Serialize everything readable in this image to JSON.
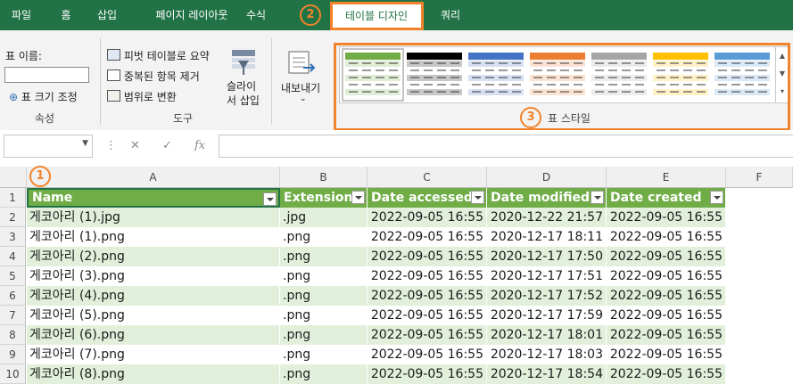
{
  "tabs": [
    {
      "label": "파일"
    },
    {
      "label": "홈"
    },
    {
      "label": "삽입"
    },
    {
      "label": "페이지 레이아웃"
    },
    {
      "label": "수식"
    },
    {
      "label": "테이블 디자인"
    },
    {
      "label": "쿼리"
    }
  ],
  "annotations": {
    "n1": "1",
    "n2": "2",
    "n3": "3"
  },
  "ribbon": {
    "table_name_label": "표 이름:",
    "table_name_value": "",
    "resize_label": "표 크기 조정",
    "group_properties": "속성",
    "pivot_label": "피벗 테이블로 요약",
    "remove_dup_label": "중복된 항목 제거",
    "convert_range_label": "범위로 변환",
    "group_tools": "도구",
    "slicer_line1": "슬라이",
    "slicer_line2": "서 삽입",
    "export_label": "내보내기",
    "group_styles": "표 스타일"
  },
  "formula_bar": {
    "fx": "fx",
    "cancel": "✕",
    "confirm": "✓",
    "value": ""
  },
  "columns": [
    "A",
    "B",
    "C",
    "D",
    "E",
    "F"
  ],
  "headers": [
    "Name",
    "Extension",
    "Date accessed",
    "Date modified",
    "Date created"
  ],
  "rows": [
    {
      "row": "1"
    },
    {
      "row": "2",
      "cells": [
        "게코아리 (1).jpg",
        ".jpg",
        "2022-09-05 16:55",
        "2020-12-22 21:57",
        "2022-09-05 16:55"
      ]
    },
    {
      "row": "3",
      "cells": [
        "게코아리 (1).png",
        ".png",
        "2022-09-05 16:55",
        "2020-12-17 18:11",
        "2022-09-05 16:55"
      ]
    },
    {
      "row": "4",
      "cells": [
        "게코아리 (2).png",
        ".png",
        "2022-09-05 16:55",
        "2020-12-17 17:50",
        "2022-09-05 16:55"
      ]
    },
    {
      "row": "5",
      "cells": [
        "게코아리 (3).png",
        ".png",
        "2022-09-05 16:55",
        "2020-12-17 17:51",
        "2022-09-05 16:55"
      ]
    },
    {
      "row": "6",
      "cells": [
        "게코아리 (4).png",
        ".png",
        "2022-09-05 16:55",
        "2020-12-17 17:52",
        "2022-09-05 16:55"
      ]
    },
    {
      "row": "7",
      "cells": [
        "게코아리 (5).png",
        ".png",
        "2022-09-05 16:55",
        "2020-12-17 17:59",
        "2022-09-05 16:55"
      ]
    },
    {
      "row": "8",
      "cells": [
        "게코아리 (6).png",
        ".png",
        "2022-09-05 16:55",
        "2020-12-17 18:01",
        "2022-09-05 16:55"
      ]
    },
    {
      "row": "9",
      "cells": [
        "게코아리 (7).png",
        ".png",
        "2022-09-05 16:55",
        "2020-12-17 18:03",
        "2022-09-05 16:55"
      ]
    },
    {
      "row": "10",
      "cells": [
        "게코아리 (8).png",
        ".png",
        "2022-09-05 16:55",
        "2020-12-17 18:54",
        "2022-09-05 16:55"
      ]
    }
  ],
  "style_colors": [
    "#70ad47",
    "#000000",
    "#4472c4",
    "#ed7d31",
    "#a5a5a5",
    "#ffc000",
    "#5b9bd5"
  ],
  "colors": {
    "ribbon_green": "#217346",
    "table_header": "#70ad47",
    "band": "#e2efda",
    "highlight": "#f2832b"
  }
}
